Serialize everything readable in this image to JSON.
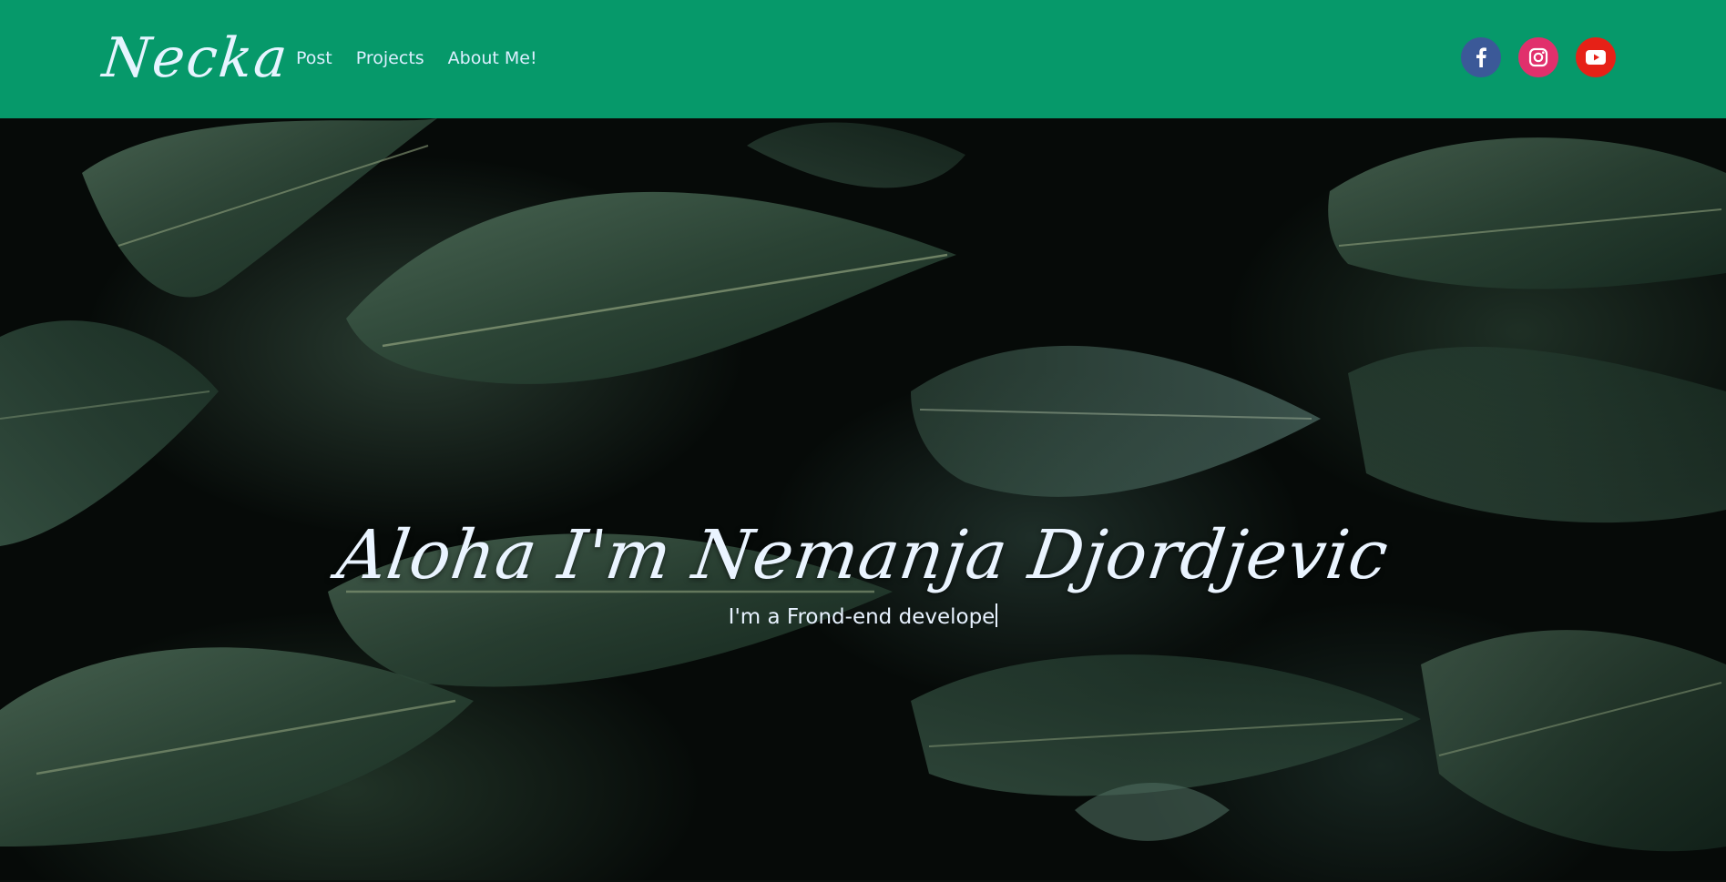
{
  "navbar": {
    "brand": "Necka",
    "links": [
      {
        "label": "Post"
      },
      {
        "label": "Projects"
      },
      {
        "label": "About Me!"
      }
    ],
    "social": [
      {
        "name": "facebook",
        "icon": "facebook-icon",
        "color": "#3b5998"
      },
      {
        "name": "instagram",
        "icon": "instagram-icon",
        "color": "#e1306c"
      },
      {
        "name": "youtube",
        "icon": "youtube-icon",
        "color": "#e62117"
      }
    ],
    "background": "#06996a"
  },
  "hero": {
    "title": "Aloha I'm Nemanja Djordjevic",
    "subtitle": "I'm a Frond-end develope"
  }
}
